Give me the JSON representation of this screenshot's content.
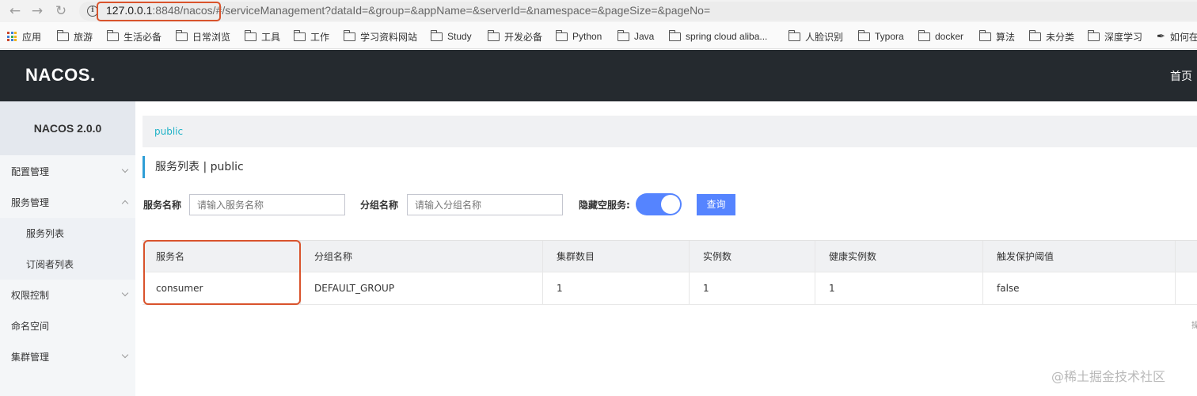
{
  "browser": {
    "url_prefix": "127.0.0.1",
    "url_middle": ":8848/nacos/",
    "url_rest": "#/serviceManagement?dataId=&group=&appName=&serverId=&namespace=&pageSize=&pageNo=",
    "bookmarks": [
      {
        "label": "应用",
        "icon": "apps-icon"
      },
      {
        "label": "旅游",
        "icon": "folder-icon"
      },
      {
        "label": "生活必备",
        "icon": "folder-icon"
      },
      {
        "label": "日常浏览",
        "icon": "folder-icon"
      },
      {
        "label": "工具",
        "icon": "folder-icon"
      },
      {
        "label": "工作",
        "icon": "folder-icon"
      },
      {
        "label": "学习资料网站",
        "icon": "folder-icon"
      },
      {
        "label": "Study",
        "icon": "folder-icon"
      },
      {
        "label": "开发必备",
        "icon": "folder-icon"
      },
      {
        "label": "Python",
        "icon": "folder-icon"
      },
      {
        "label": "Java",
        "icon": "folder-icon"
      },
      {
        "label": "spring cloud aliba...",
        "icon": "folder-icon"
      },
      {
        "label": "人脸识别",
        "icon": "folder-icon"
      },
      {
        "label": "Typora",
        "icon": "folder-icon"
      },
      {
        "label": "docker",
        "icon": "folder-icon"
      },
      {
        "label": "算法",
        "icon": "folder-icon"
      },
      {
        "label": "未分类",
        "icon": "folder-icon"
      },
      {
        "label": "深度学习",
        "icon": "folder-icon"
      },
      {
        "label": "如何在",
        "icon": "feather-icon"
      }
    ]
  },
  "header": {
    "logo": "NACOS.",
    "home": "首页"
  },
  "sidebar": {
    "title": "NACOS 2.0.0",
    "items": [
      {
        "label": "配置管理"
      },
      {
        "label": "服务管理"
      },
      {
        "label": "服务列表"
      },
      {
        "label": "订阅者列表"
      },
      {
        "label": "权限控制"
      },
      {
        "label": "命名空间"
      },
      {
        "label": "集群管理"
      }
    ]
  },
  "main": {
    "breadcrumb": "public",
    "title": "服务列表  |  public",
    "filters": {
      "service_name_label": "服务名称",
      "service_name_placeholder": "请输入服务名称",
      "group_name_label": "分组名称",
      "group_name_placeholder": "请输入分组名称",
      "hide_empty_label": "隐藏空服务:",
      "hide_empty_on": true,
      "query_button": "查询"
    },
    "table": {
      "headers": [
        "服务名",
        "分组名称",
        "集群数目",
        "实例数",
        "健康实例数",
        "触发保护阈值"
      ],
      "rows": [
        [
          "consumer",
          "DEFAULT_GROUP",
          "1",
          "1",
          "1",
          "false"
        ]
      ]
    }
  },
  "watermark": "@稀土掘金技术社区",
  "edge_text": "操"
}
